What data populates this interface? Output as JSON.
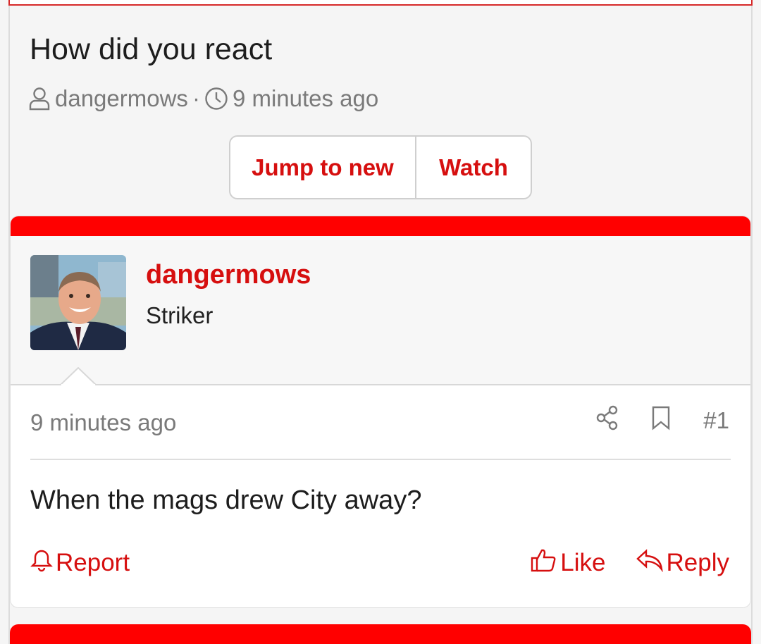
{
  "thread": {
    "title": "How did you react",
    "author": "dangermows",
    "separator": "·",
    "time": "9 minutes ago"
  },
  "buttons": {
    "jump_to_new": "Jump to new",
    "watch": "Watch"
  },
  "post": {
    "username": "dangermows",
    "user_title": "Striker",
    "time": "9 minutes ago",
    "number": "#1",
    "body": "When the mags drew City away?",
    "report_label": "Report",
    "like_label": "Like",
    "reply_label": "Reply"
  },
  "colors": {
    "accent": "#d60f0f",
    "brand_bar": "#ff0000",
    "muted": "#7a7a7a"
  },
  "icons": [
    "user-icon",
    "clock-icon",
    "share-icon",
    "bookmark-icon",
    "bell-icon",
    "thumbs-up-icon",
    "reply-icon"
  ]
}
